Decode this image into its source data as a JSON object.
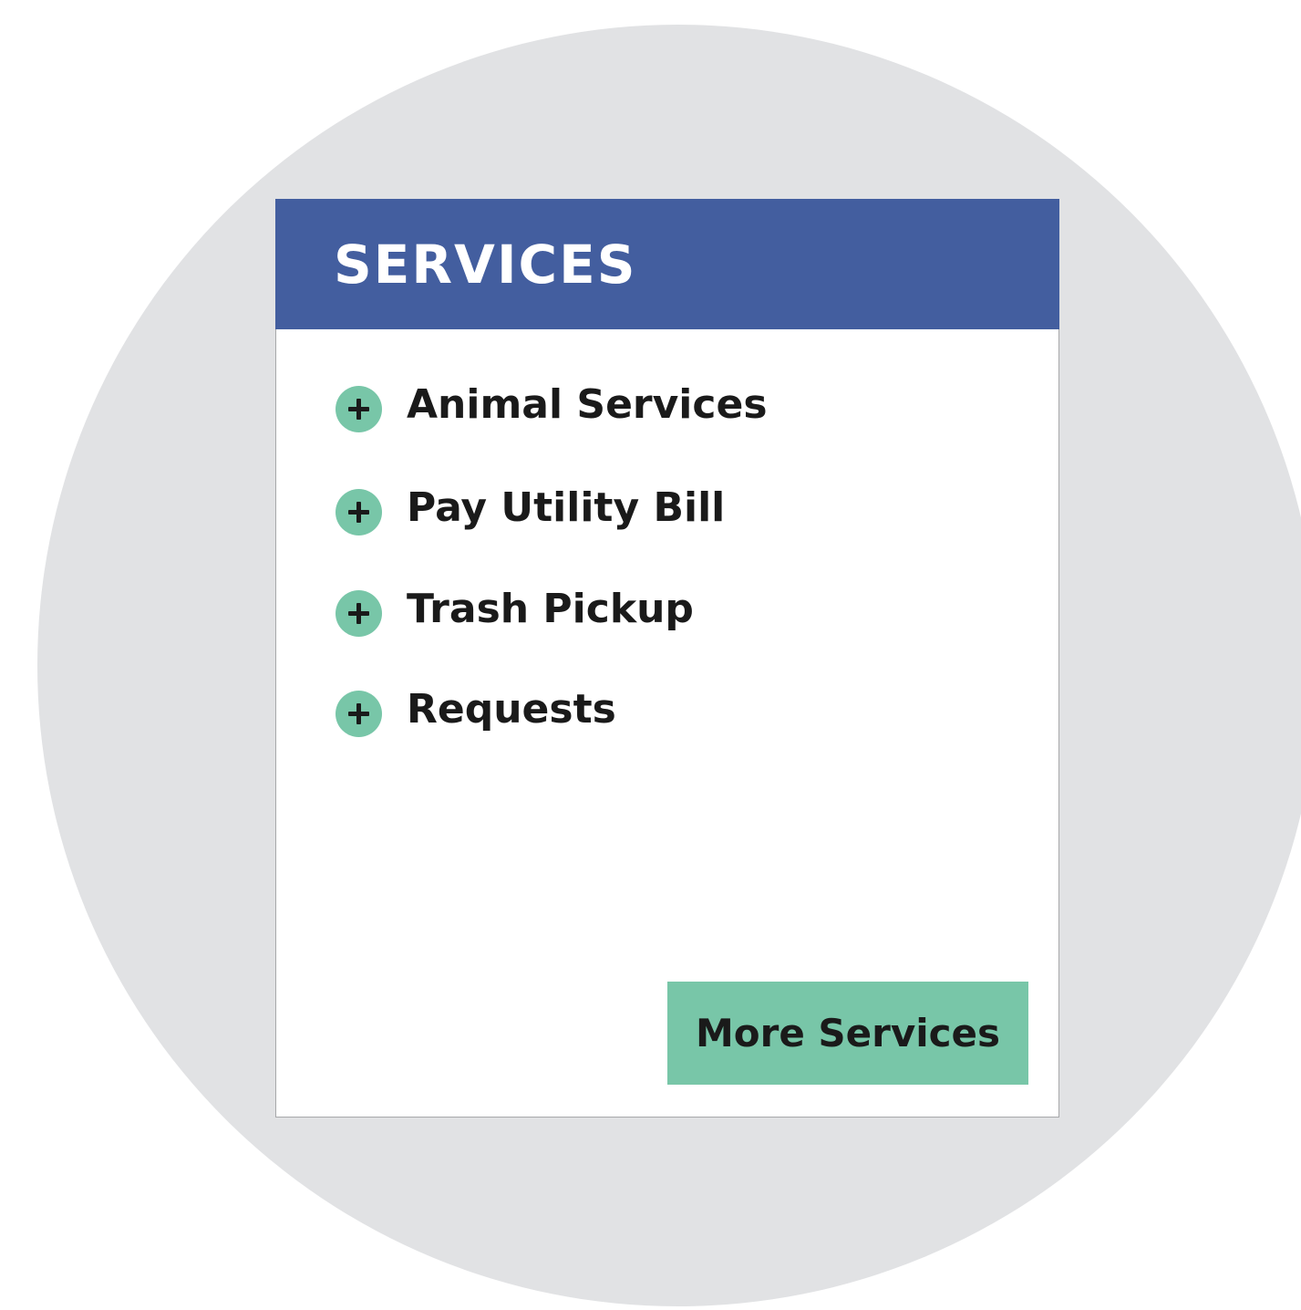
{
  "background": {
    "circle_color": "#e1e2e4"
  },
  "card": {
    "title": "SERVICES",
    "header_color": "#435e9f",
    "items": [
      {
        "label": "Animal Services",
        "icon": "plus-circle-icon"
      },
      {
        "label": "Pay Utility Bill",
        "icon": "plus-circle-icon"
      },
      {
        "label": "Trash Pickup",
        "icon": "plus-circle-icon"
      },
      {
        "label": "Requests",
        "icon": "plus-circle-icon"
      }
    ],
    "accent_color": "#78c6a8",
    "more_button_label": "More Services"
  }
}
